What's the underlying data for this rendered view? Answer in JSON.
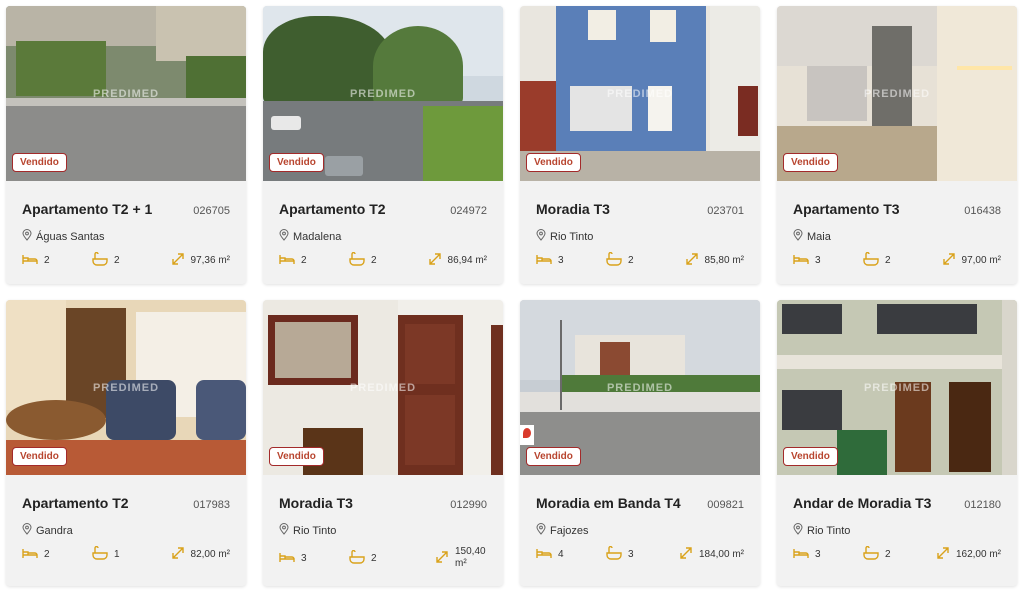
{
  "colors": {
    "accent": "#d9a21b",
    "badge_border": "#a32a2a",
    "badge_text": "#b8452f",
    "card_bg": "#f2f2f2"
  },
  "watermark": "PREDIMED",
  "listings": [
    {
      "status": "Vendido",
      "title": "Apartamento T2 + 1",
      "ref": "026705",
      "location": "Águas Santas",
      "beds": "2",
      "baths": "2",
      "area": "97,36 m²"
    },
    {
      "status": "Vendido",
      "title": "Apartamento T2",
      "ref": "024972",
      "location": "Madalena",
      "beds": "2",
      "baths": "2",
      "area": "86,94 m²"
    },
    {
      "status": "Vendido",
      "title": "Moradia T3",
      "ref": "023701",
      "location": "Rio Tinto",
      "beds": "3",
      "baths": "2",
      "area": "85,80 m²"
    },
    {
      "status": "Vendido",
      "title": "Apartamento T3",
      "ref": "016438",
      "location": "Maia",
      "beds": "3",
      "baths": "2",
      "area": "97,00 m²"
    },
    {
      "status": "Vendido",
      "title": "Apartamento T2",
      "ref": "017983",
      "location": "Gandra",
      "beds": "2",
      "baths": "1",
      "area": "82,00 m²"
    },
    {
      "status": "Vendido",
      "title": "Moradia T3",
      "ref": "012990",
      "location": "Rio Tinto",
      "beds": "3",
      "baths": "2",
      "area": "150,40 m²"
    },
    {
      "status": "Vendido",
      "title": "Moradia em Banda T4",
      "ref": "009821",
      "location": "Fajozes",
      "beds": "4",
      "baths": "3",
      "area": "184,00 m²"
    },
    {
      "status": "Vendido",
      "title": "Andar de Moradia T3",
      "ref": "012180",
      "location": "Rio Tinto",
      "beds": "3",
      "baths": "2",
      "area": "162,00 m²"
    }
  ]
}
